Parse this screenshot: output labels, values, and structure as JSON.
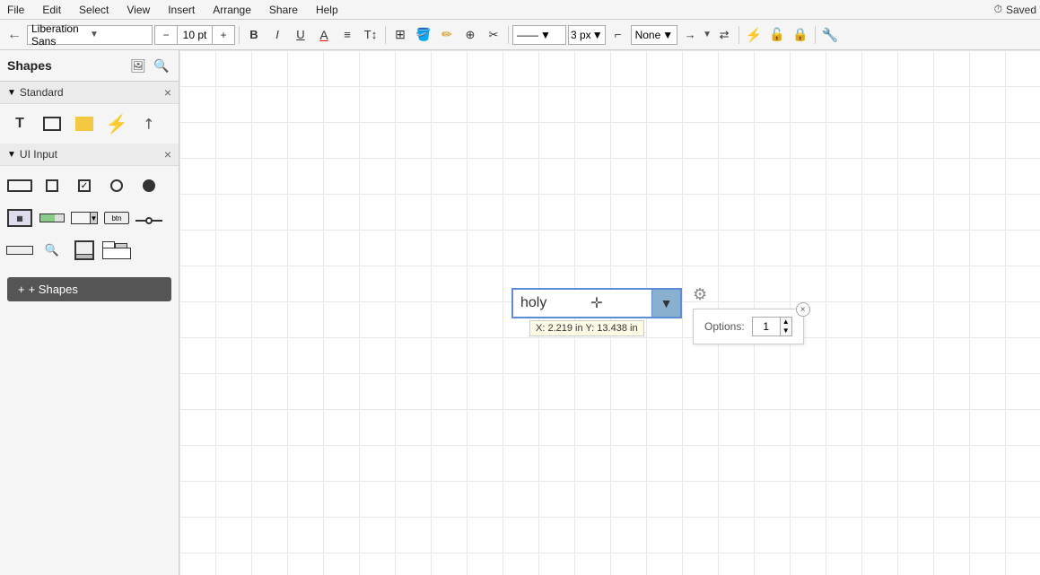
{
  "menubar": {
    "items": [
      "File",
      "Edit",
      "Select",
      "View",
      "Insert",
      "Arrange",
      "Share",
      "Help"
    ],
    "saved_label": "Saved",
    "extra_icon": "👁️"
  },
  "toolbar": {
    "back_arrow": "←",
    "font_name": "Liberation Sans",
    "font_size": "10 pt",
    "bold_label": "B",
    "italic_label": "I",
    "underline_label": "U",
    "line_style": "——",
    "px_value": "3 px",
    "connection_label": "None",
    "arrow_right": "→",
    "arrow_swap": "⇄"
  },
  "sidebar": {
    "title": "Shapes",
    "sections": [
      {
        "name": "Standard",
        "shapes": [
          {
            "id": "text",
            "symbol": "T"
          },
          {
            "id": "rect",
            "symbol": "☐"
          },
          {
            "id": "rect-yellow",
            "symbol": "■"
          },
          {
            "id": "bolt",
            "symbol": "⚡"
          },
          {
            "id": "arrow",
            "symbol": "↗"
          }
        ]
      },
      {
        "name": "UI Input",
        "shapes": [
          {
            "id": "input-field",
            "symbol": "input"
          },
          {
            "id": "checkbox-empty",
            "symbol": "☐"
          },
          {
            "id": "checkbox-check",
            "symbol": "☑"
          },
          {
            "id": "radio-empty",
            "symbol": "○"
          },
          {
            "id": "radio-filled",
            "symbol": "◉"
          },
          {
            "id": "display",
            "symbol": "▦"
          },
          {
            "id": "progress-bar",
            "symbol": "▬"
          },
          {
            "id": "combo-box",
            "symbol": "▤"
          },
          {
            "id": "button-label",
            "symbol": "⊟"
          },
          {
            "id": "slider",
            "symbol": "⊸"
          },
          {
            "id": "scroll-h",
            "symbol": "▭"
          },
          {
            "id": "zoom-bar",
            "symbol": "🔍"
          },
          {
            "id": "frame-scroll",
            "symbol": "▣"
          },
          {
            "id": "tabs",
            "symbol": "⊞"
          }
        ]
      }
    ],
    "add_shapes_label": "+ Shapes"
  },
  "canvas": {
    "dropdown_text": "holy",
    "dropdown_arrow": "▼",
    "coord_label": "X: 2.219 in  Y: 13.438 in",
    "gear_symbol": "⚙",
    "options_label": "Options:",
    "options_value": "1",
    "close_symbol": "×"
  }
}
